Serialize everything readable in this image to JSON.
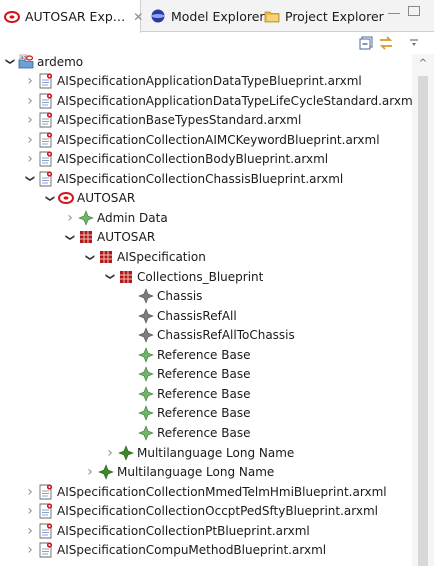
{
  "tabs": [
    {
      "label": "AUTOSAR Exp…",
      "close": "✕"
    },
    {
      "label": "Model Explorer"
    },
    {
      "label": "Project Explorer"
    }
  ],
  "tree": [
    {
      "label": "ardemo",
      "level": 0,
      "arrow": "open",
      "icon": "project-folder"
    },
    {
      "label": "AISpecificationApplicationDataTypeBlueprint.arxml",
      "level": 1,
      "arrow": "closed",
      "icon": "arxml-file"
    },
    {
      "label": "AISpecificationApplicationDataTypeLifeCycleStandard.arxml",
      "level": 1,
      "arrow": "closed",
      "icon": "arxml-file"
    },
    {
      "label": "AISpecificationBaseTypesStandard.arxml",
      "level": 1,
      "arrow": "closed",
      "icon": "arxml-file"
    },
    {
      "label": "AISpecificationCollectionAIMCKeywordBlueprint.arxml",
      "level": 1,
      "arrow": "closed",
      "icon": "arxml-file"
    },
    {
      "label": "AISpecificationCollectionBodyBlueprint.arxml",
      "level": 1,
      "arrow": "closed",
      "icon": "arxml-file"
    },
    {
      "label": "AISpecificationCollectionChassisBlueprint.arxml",
      "level": 1,
      "arrow": "open",
      "icon": "arxml-file"
    },
    {
      "label": "AUTOSAR",
      "level": 2,
      "arrow": "open",
      "icon": "autosar-root"
    },
    {
      "label": "Admin Data",
      "level": 3,
      "arrow": "closed",
      "icon": "diamond-green"
    },
    {
      "label": "AUTOSAR",
      "level": 3,
      "arrow": "open",
      "icon": "package"
    },
    {
      "label": "AISpecification",
      "level": 4,
      "arrow": "open",
      "icon": "package"
    },
    {
      "label": "Collections_Blueprint",
      "level": 5,
      "arrow": "open",
      "icon": "package"
    },
    {
      "label": "Chassis",
      "level": 6,
      "arrow": "none",
      "icon": "diamond-gray"
    },
    {
      "label": "ChassisRefAll",
      "level": 6,
      "arrow": "none",
      "icon": "diamond-gray"
    },
    {
      "label": "ChassisRefAllToChassis",
      "level": 6,
      "arrow": "none",
      "icon": "diamond-gray"
    },
    {
      "label": "Reference Base",
      "level": 6,
      "arrow": "none",
      "icon": "diamond-green"
    },
    {
      "label": "Reference Base",
      "level": 6,
      "arrow": "none",
      "icon": "diamond-green"
    },
    {
      "label": "Reference Base",
      "level": 6,
      "arrow": "none",
      "icon": "diamond-green"
    },
    {
      "label": "Reference Base",
      "level": 6,
      "arrow": "none",
      "icon": "diamond-green"
    },
    {
      "label": "Reference Base",
      "level": 6,
      "arrow": "none",
      "icon": "diamond-green"
    },
    {
      "label": "Multilanguage Long Name",
      "level": 5,
      "arrow": "closed",
      "icon": "diamond-green-dark"
    },
    {
      "label": "Multilanguage Long Name",
      "level": 4,
      "arrow": "closed",
      "icon": "diamond-green-dark"
    },
    {
      "label": "AISpecificationCollectionMmedTelmHmiBlueprint.arxml",
      "level": 1,
      "arrow": "closed",
      "icon": "arxml-file"
    },
    {
      "label": "AISpecificationCollectionOccptPedSftyBlueprint.arxml",
      "level": 1,
      "arrow": "closed",
      "icon": "arxml-file"
    },
    {
      "label": "AISpecificationCollectionPtBlueprint.arxml",
      "level": 1,
      "arrow": "closed",
      "icon": "arxml-file"
    },
    {
      "label": "AISpecificationCompuMethodBlueprint.arxml",
      "level": 1,
      "arrow": "closed",
      "icon": "arxml-file"
    }
  ]
}
